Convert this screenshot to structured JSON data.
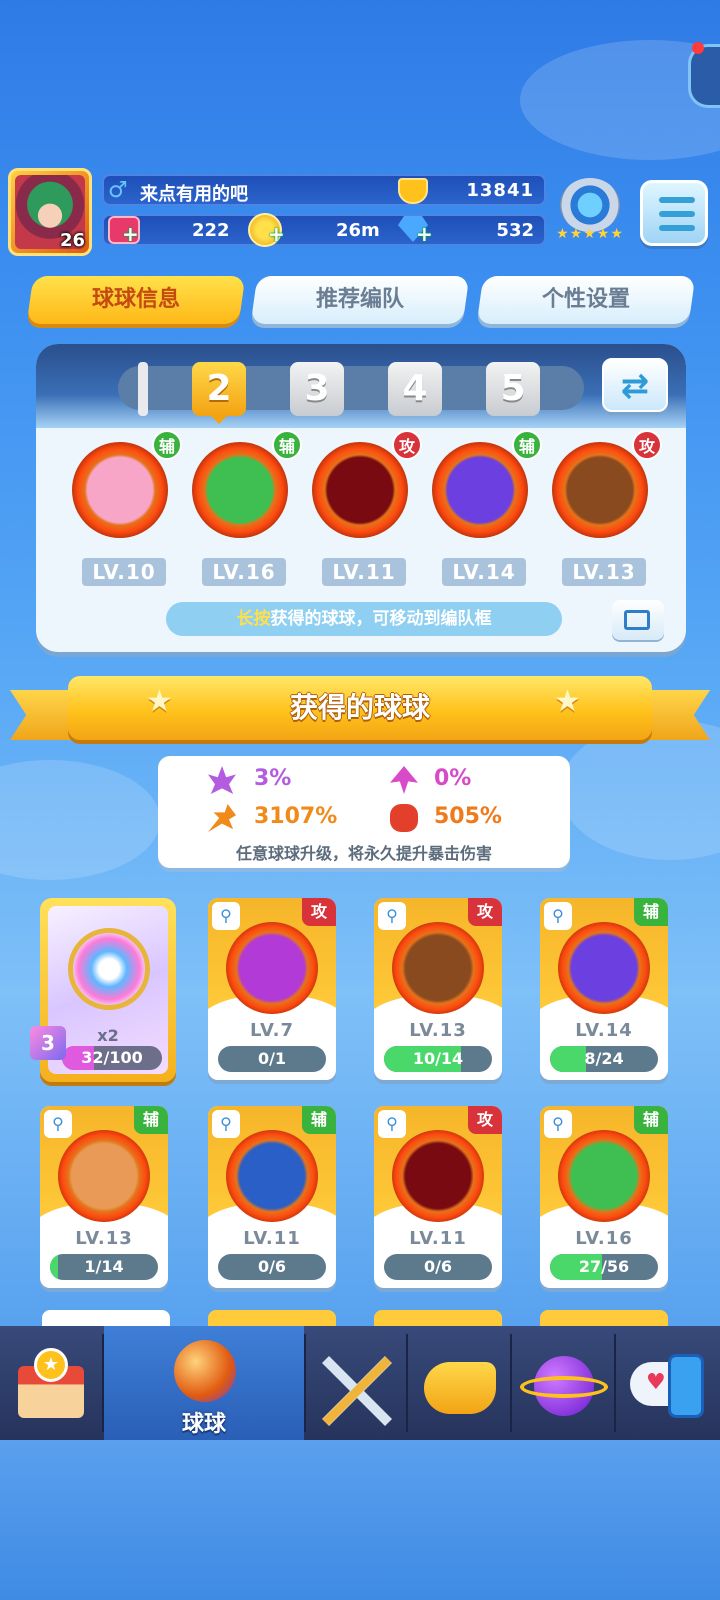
{
  "player": {
    "name": "来点有用的吧",
    "gender_symbol": "♂",
    "level": "26",
    "trophies": "13841",
    "tickets": "222",
    "gold": "26m",
    "gems": "532"
  },
  "tabs": [
    "球球信息",
    "推荐编队",
    "个性设置"
  ],
  "team": {
    "slots": [
      "2",
      "3",
      "4",
      "5"
    ],
    "members": [
      {
        "level": "LV.10",
        "role": "辅",
        "role_type": "support",
        "ball_color": "#f7a6c8"
      },
      {
        "level": "LV.16",
        "role": "辅",
        "role_type": "support",
        "ball_color": "#3fbf52"
      },
      {
        "level": "LV.11",
        "role": "攻",
        "role_type": "attack",
        "ball_color": "#7a0a12"
      },
      {
        "level": "LV.14",
        "role": "辅",
        "role_type": "support",
        "ball_color": "#6b3fe0"
      },
      {
        "level": "LV.13",
        "role": "攻",
        "role_type": "attack",
        "ball_color": "#8a4a20"
      }
    ],
    "hint_highlight": "长按",
    "hint_text": "获得的球球，可移动到编队框"
  },
  "section_title": "获得的球球",
  "stats": {
    "items": [
      {
        "value": "3%",
        "color": "#b45ce0",
        "icon": "crit-rate-icon"
      },
      {
        "value": "0%",
        "color": "#d84ac8",
        "icon": "pierce-icon"
      },
      {
        "value": "3107%",
        "color": "#f08a1a",
        "icon": "crit-damage-icon"
      },
      {
        "value": "505%",
        "color": "#f07a1a",
        "icon": "power-icon"
      }
    ],
    "note": "任意球球升级，将永久提升暴击伤害"
  },
  "special_card": {
    "count": "x2",
    "progress": "32/100",
    "fraction": 0.32,
    "badge": "3"
  },
  "cards": [
    {
      "level": "LV.7",
      "progress": "0/1",
      "fraction": 0,
      "role": "攻",
      "role_color": "#d8333a",
      "ball_color": "#b23ad6"
    },
    {
      "level": "LV.13",
      "progress": "10/14",
      "fraction": 0.71,
      "role": "攻",
      "role_color": "#d8333a",
      "ball_color": "#8a4a20"
    },
    {
      "level": "LV.14",
      "progress": "8/24",
      "fraction": 0.33,
      "role": "辅",
      "role_color": "#3ab23e",
      "ball_color": "#6b3fe0"
    },
    {
      "level": "LV.13",
      "progress": "1/14",
      "fraction": 0.07,
      "role": "辅",
      "role_color": "#3ab23e",
      "ball_color": "#e89a56"
    },
    {
      "level": "LV.11",
      "progress": "0/6",
      "fraction": 0,
      "role": "辅",
      "role_color": "#3ab23e",
      "ball_color": "#2a5fc8"
    },
    {
      "level": "LV.11",
      "progress": "0/6",
      "fraction": 0,
      "role": "攻",
      "role_color": "#d8333a",
      "ball_color": "#7a0a12"
    },
    {
      "level": "LV.16",
      "progress": "27/56",
      "fraction": 0.48,
      "role": "辅",
      "role_color": "#3ab23e",
      "ball_color": "#3fbf52"
    }
  ],
  "nav": {
    "active_label": "球球",
    "items": [
      "shop-icon",
      "balls-icon",
      "battle-icon",
      "whistle-icon",
      "planet-icon",
      "chat-icon"
    ]
  }
}
